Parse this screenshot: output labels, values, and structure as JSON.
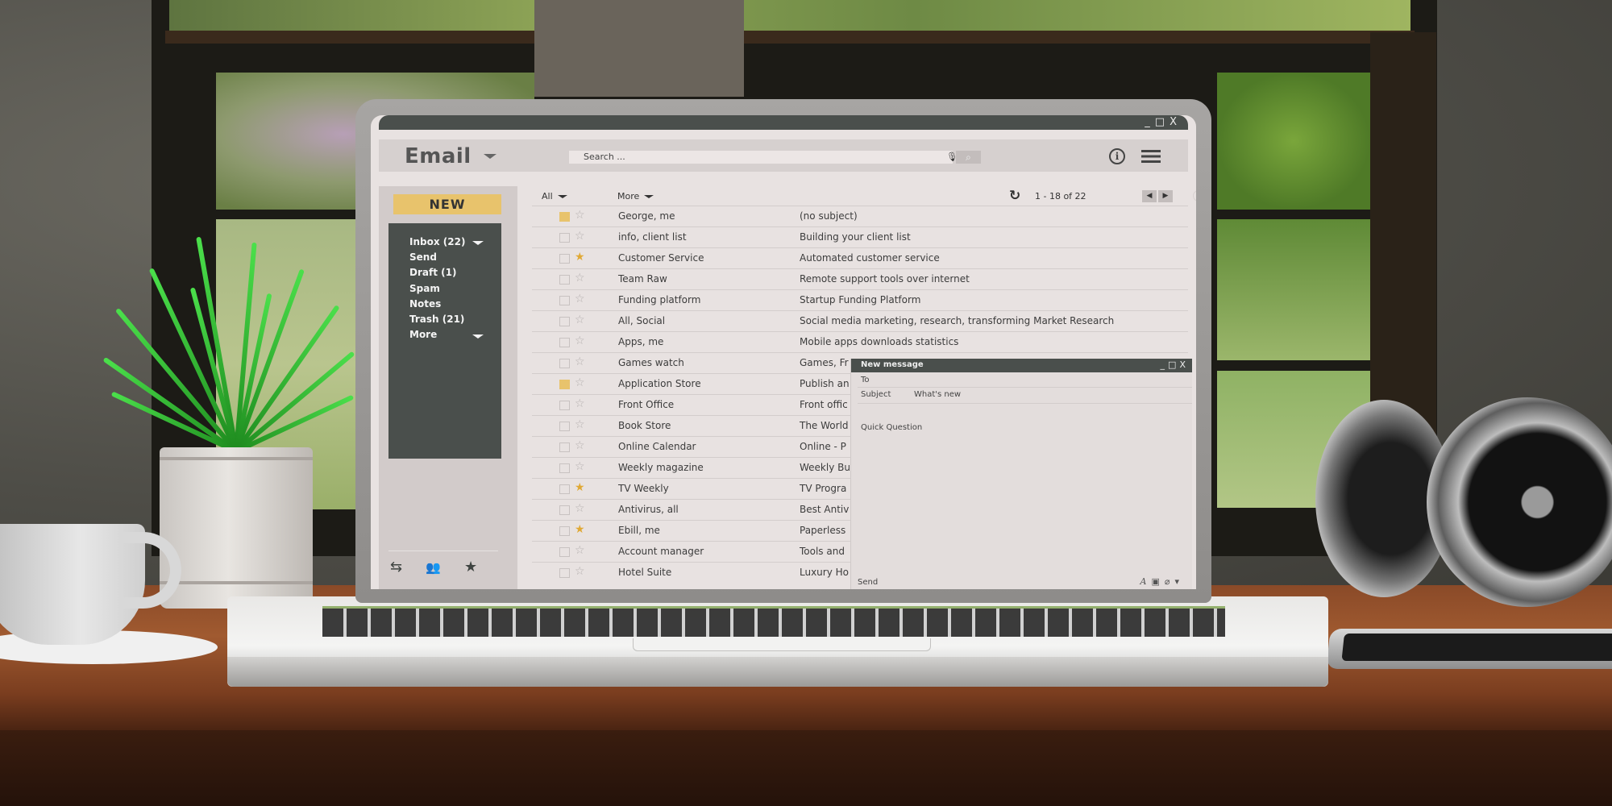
{
  "window": {
    "controls": [
      "_",
      "□",
      "X"
    ]
  },
  "app": {
    "title": "Email",
    "title_icon": "chevron-down-icon",
    "search_placeholder": "Search ...",
    "mic_icon": "microphone-icon",
    "search_icon": "search-icon",
    "info_icon": "info-icon",
    "menu_icon": "hamburger-menu-icon"
  },
  "sidebar": {
    "new_label": "NEW",
    "folders": [
      {
        "label": "Inbox (22)",
        "has_caret": true
      },
      {
        "label": "Send"
      },
      {
        "label": "Draft (1)"
      },
      {
        "label": "Spam"
      },
      {
        "label": "Notes"
      },
      {
        "label": "Trash (21)"
      },
      {
        "label": "More",
        "has_caret": true
      }
    ],
    "tools": [
      {
        "icon": "swap-arrows-icon",
        "glyph": "⇆"
      },
      {
        "icon": "contacts-icon",
        "glyph": "👥"
      },
      {
        "icon": "star-icon",
        "glyph": "★"
      }
    ]
  },
  "toolbar": {
    "all_label": "All",
    "more_label": "More",
    "refresh_glyph": "↻",
    "pagination": "1 - 18 of 22",
    "prev_glyph": "◀",
    "next_glyph": "▶"
  },
  "emails": [
    {
      "sender": "George, me",
      "subject": "(no subject)",
      "selected": true,
      "starred": false
    },
    {
      "sender": "info, client list",
      "subject": "Building your client list",
      "selected": false,
      "starred": false
    },
    {
      "sender": "Customer Service",
      "subject": "Automated customer service",
      "selected": false,
      "starred": true
    },
    {
      "sender": "Team Raw",
      "subject": "Remote support tools over internet",
      "selected": false,
      "starred": false
    },
    {
      "sender": "Funding platform",
      "subject": "Startup Funding Platform",
      "selected": false,
      "starred": false
    },
    {
      "sender": "All, Social",
      "subject": "Social media marketing, research, transforming Market Research",
      "selected": false,
      "starred": false
    },
    {
      "sender": "Apps, me",
      "subject": "Mobile apps downloads statistics",
      "selected": false,
      "starred": false
    },
    {
      "sender": "Games watch",
      "subject": "Games, Fr",
      "selected": false,
      "starred": false
    },
    {
      "sender": "Application Store",
      "subject": "Publish an",
      "selected": true,
      "starred": false
    },
    {
      "sender": "Front Office",
      "subject": "Front offic",
      "selected": false,
      "starred": false
    },
    {
      "sender": "Book Store",
      "subject": "The World",
      "selected": false,
      "starred": false
    },
    {
      "sender": "Online Calendar",
      "subject": "Online - P",
      "selected": false,
      "starred": false
    },
    {
      "sender": "Weekly magazine",
      "subject": "Weekly Bu",
      "selected": false,
      "starred": false
    },
    {
      "sender": "TV Weekly",
      "subject": "TV Progra",
      "selected": false,
      "starred": true
    },
    {
      "sender": "Antivirus, all",
      "subject": "Best Antiv",
      "selected": false,
      "starred": false
    },
    {
      "sender": "Ebill, me",
      "subject": "Paperless",
      "selected": false,
      "starred": true
    },
    {
      "sender": "Account manager",
      "subject": "Tools and",
      "selected": false,
      "starred": false
    },
    {
      "sender": "Hotel Suite",
      "subject": "Luxury Ho",
      "selected": false,
      "starred": false
    }
  ],
  "compose": {
    "title": "New message",
    "controls": [
      "_",
      "□",
      "X"
    ],
    "to_label": "To",
    "to_value": "",
    "subject_label": "Subject",
    "subject_value": "What's new",
    "body": "Quick Question",
    "send_label": "Send",
    "tools": [
      {
        "icon": "font-format-icon",
        "glyph": "A"
      },
      {
        "icon": "insert-image-icon",
        "glyph": "▣"
      },
      {
        "icon": "attachment-icon",
        "glyph": "⌀"
      },
      {
        "icon": "more-options-caret-icon",
        "glyph": "▾"
      }
    ]
  },
  "colors": {
    "accent": "#e8c36c",
    "star_on": "#e0a935",
    "dark_panel": "#4a4f4c",
    "screen_bg": "#e8e2e1"
  }
}
